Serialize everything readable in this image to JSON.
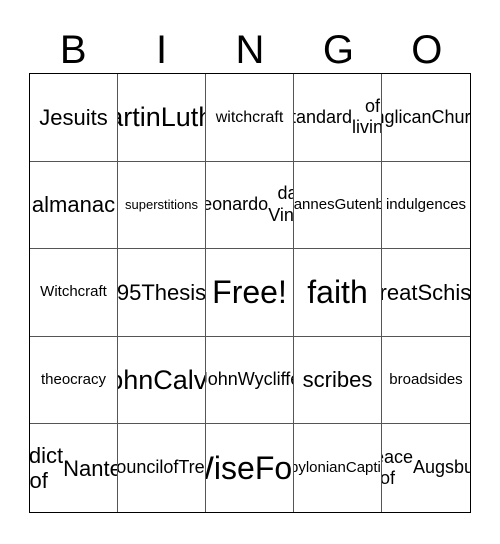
{
  "card": {
    "header": [
      "B",
      "I",
      "N",
      "G",
      "O"
    ],
    "rows": [
      [
        {
          "lines": [
            "Jesuits"
          ],
          "size": "l"
        },
        {
          "lines": [
            "Martin",
            "Luther"
          ],
          "size": "xl"
        },
        {
          "lines": [
            "witchcraft"
          ],
          "size": "s"
        },
        {
          "lines": [
            "standard",
            "of living"
          ],
          "size": "m"
        },
        {
          "lines": [
            "Anglican",
            "Church"
          ],
          "size": "m"
        }
      ],
      [
        {
          "lines": [
            "almanac"
          ],
          "size": "l"
        },
        {
          "lines": [
            "superstitions"
          ],
          "size": "xxs"
        },
        {
          "lines": [
            "Leonardo",
            "da Vinci"
          ],
          "size": "m"
        },
        {
          "lines": [
            "Johannes",
            "Gutenberg"
          ],
          "size": "xs"
        },
        {
          "lines": [
            "indulgences"
          ],
          "size": "xs"
        }
      ],
      [
        {
          "lines": [
            "Witchcraft"
          ],
          "size": "xs"
        },
        {
          "lines": [
            "95",
            "Thesis"
          ],
          "size": "l"
        },
        {
          "lines": [
            "Free!"
          ],
          "size": "xxl",
          "free": true
        },
        {
          "lines": [
            "faith"
          ],
          "size": "xxl"
        },
        {
          "lines": [
            "Great",
            "Schism"
          ],
          "size": "l"
        }
      ],
      [
        {
          "lines": [
            "theocracy"
          ],
          "size": "xs"
        },
        {
          "lines": [
            "John",
            "Calvin"
          ],
          "size": "xl"
        },
        {
          "lines": [
            "John",
            "Wycliffe"
          ],
          "size": "m"
        },
        {
          "lines": [
            "scribes"
          ],
          "size": "l"
        },
        {
          "lines": [
            "broadsides"
          ],
          "size": "xs"
        }
      ],
      [
        {
          "lines": [
            "Edict of",
            "Nantes"
          ],
          "size": "l"
        },
        {
          "lines": [
            "Council",
            "of",
            "Trent"
          ],
          "size": "m"
        },
        {
          "lines": [
            "Wise",
            "Folk"
          ],
          "size": "xxl"
        },
        {
          "lines": [
            "Babylonian",
            "Captivity"
          ],
          "size": "xs"
        },
        {
          "lines": [
            "Peace of",
            "Augsburg"
          ],
          "size": "m"
        }
      ]
    ]
  }
}
